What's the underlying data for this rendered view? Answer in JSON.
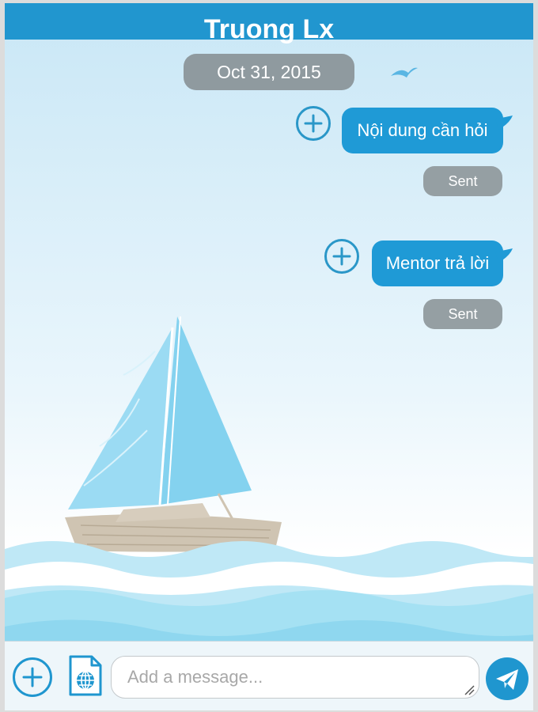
{
  "header": {
    "title": "Truong Lx",
    "color": "#2196cf"
  },
  "date_separator": "Oct 31, 2015",
  "messages": [
    {
      "text": "Nội dung cần hỏi",
      "status": "Sent"
    },
    {
      "text": "Mentor trả lời",
      "status": "Sent"
    }
  ],
  "composer": {
    "placeholder": "Add a message...",
    "add_icon": "plus-circle-icon",
    "file_icon": "globe-document-icon",
    "send_icon": "paper-plane-icon"
  }
}
